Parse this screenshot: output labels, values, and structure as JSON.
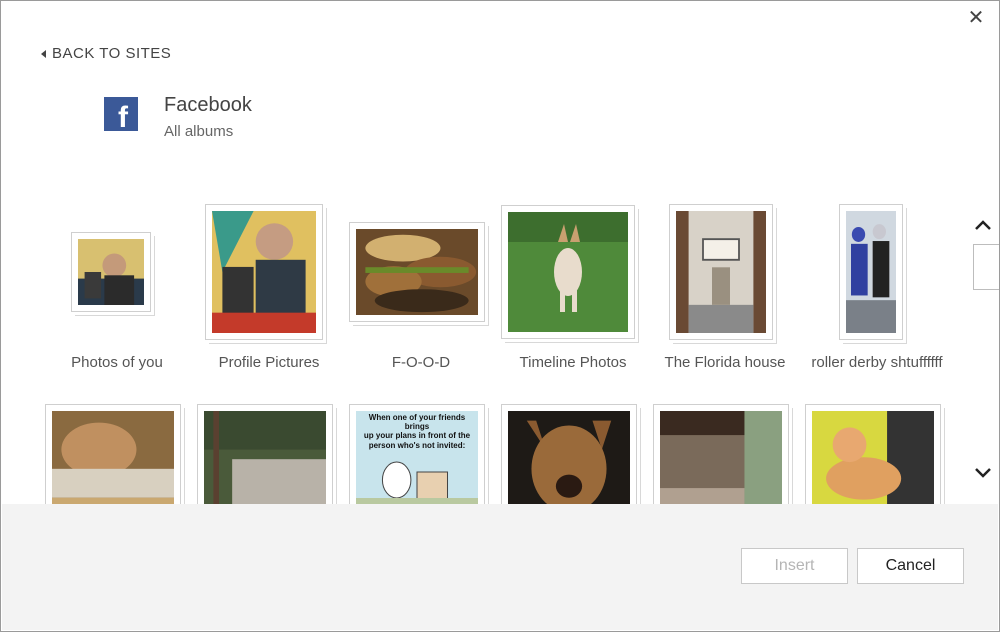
{
  "dialog": {
    "close_glyph": "✕",
    "back_label": "BACK TO SITES",
    "site_name": "Facebook",
    "site_subtitle": "All albums",
    "site_logo_letter": "f"
  },
  "albums_row1": [
    {
      "label": "Photos of you"
    },
    {
      "label": "Profile Pictures"
    },
    {
      "label": "F-O-O-D"
    },
    {
      "label": "Timeline Photos"
    },
    {
      "label": "The Florida house"
    },
    {
      "label": "roller derby shtuffffff"
    }
  ],
  "albums_row2": [
    {
      "alt": "dog lying on cushion"
    },
    {
      "alt": "stone bench in garden"
    },
    {
      "caption_line1": "When one of your friends brings",
      "caption_line2": "up your plans in front of the",
      "caption_line3": "person who's not invited:"
    },
    {
      "alt": "german shepherd face"
    },
    {
      "alt": "porch with columns"
    },
    {
      "alt": "orange cat"
    }
  ],
  "scroll": {
    "up_glyph": "⌃",
    "down_glyph": "⌄"
  },
  "footer": {
    "insert_label": "Insert",
    "cancel_label": "Cancel"
  },
  "colors": {
    "facebook_blue": "#3b5998",
    "footer_bg": "#f3f3f3"
  }
}
